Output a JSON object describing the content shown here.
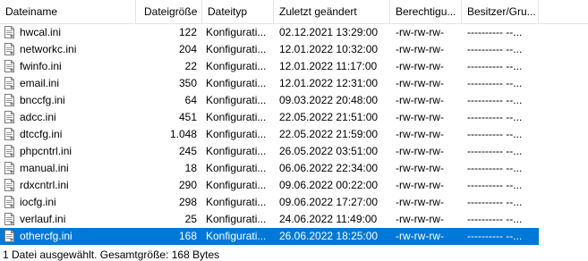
{
  "columns": {
    "name": "Dateiname",
    "size": "Dateigröße",
    "type": "Dateityp",
    "modified": "Zuletzt geändert",
    "permissions": "Berechtigu...",
    "owner": "Besitzer/Gru..."
  },
  "files": [
    {
      "name": "hwcal.ini",
      "size": "122",
      "type": "Konfigurati...",
      "modified": "02.12.2021 13:29:00",
      "permissions": "-rw-rw-rw-",
      "owner": "---------- --..."
    },
    {
      "name": "networkc.ini",
      "size": "204",
      "type": "Konfigurati...",
      "modified": "12.01.2022 10:32:00",
      "permissions": "-rw-rw-rw-",
      "owner": "---------- --..."
    },
    {
      "name": "fwinfo.ini",
      "size": "22",
      "type": "Konfigurati...",
      "modified": "12.01.2022 11:17:00",
      "permissions": "-rw-rw-rw-",
      "owner": "---------- --..."
    },
    {
      "name": "email.ini",
      "size": "350",
      "type": "Konfigurati...",
      "modified": "12.01.2022 12:31:00",
      "permissions": "-rw-rw-rw-",
      "owner": "---------- --..."
    },
    {
      "name": "bnccfg.ini",
      "size": "64",
      "type": "Konfigurati...",
      "modified": "09.03.2022 20:48:00",
      "permissions": "-rw-rw-rw-",
      "owner": "---------- --..."
    },
    {
      "name": "adcc.ini",
      "size": "451",
      "type": "Konfigurati...",
      "modified": "22.05.2022 21:51:00",
      "permissions": "-rw-rw-rw-",
      "owner": "---------- --..."
    },
    {
      "name": "dtccfg.ini",
      "size": "1.048",
      "type": "Konfigurati...",
      "modified": "22.05.2022 21:59:00",
      "permissions": "-rw-rw-rw-",
      "owner": "---------- --..."
    },
    {
      "name": "phpcntrl.ini",
      "size": "245",
      "type": "Konfigurati...",
      "modified": "26.05.2022 03:51:00",
      "permissions": "-rw-rw-rw-",
      "owner": "---------- --..."
    },
    {
      "name": "manual.ini",
      "size": "18",
      "type": "Konfigurati...",
      "modified": "06.06.2022 22:34:00",
      "permissions": "-rw-rw-rw-",
      "owner": "---------- --..."
    },
    {
      "name": "rdxcntrl.ini",
      "size": "290",
      "type": "Konfigurati...",
      "modified": "09.06.2022 00:22:00",
      "permissions": "-rw-rw-rw-",
      "owner": "---------- --..."
    },
    {
      "name": "iocfg.ini",
      "size": "298",
      "type": "Konfigurati...",
      "modified": "09.06.2022 17:27:00",
      "permissions": "-rw-rw-rw-",
      "owner": "---------- --..."
    },
    {
      "name": "verlauf.ini",
      "size": "25",
      "type": "Konfigurati...",
      "modified": "24.06.2022 11:49:00",
      "permissions": "-rw-rw-rw-",
      "owner": "---------- --..."
    },
    {
      "name": "othercfg.ini",
      "size": "168",
      "type": "Konfigurati...",
      "modified": "26.06.2022 18:25:00",
      "permissions": "-rw-rw-rw-",
      "owner": "---------- --...",
      "selected": true
    }
  ],
  "icons": {
    "file": "ini-file-icon"
  },
  "colors": {
    "selection": "#0078d7",
    "header_divider": "#e5e5e5"
  },
  "status": {
    "text": "1 Datei ausgewählt. Gesamtgröße: 168 Bytes"
  }
}
